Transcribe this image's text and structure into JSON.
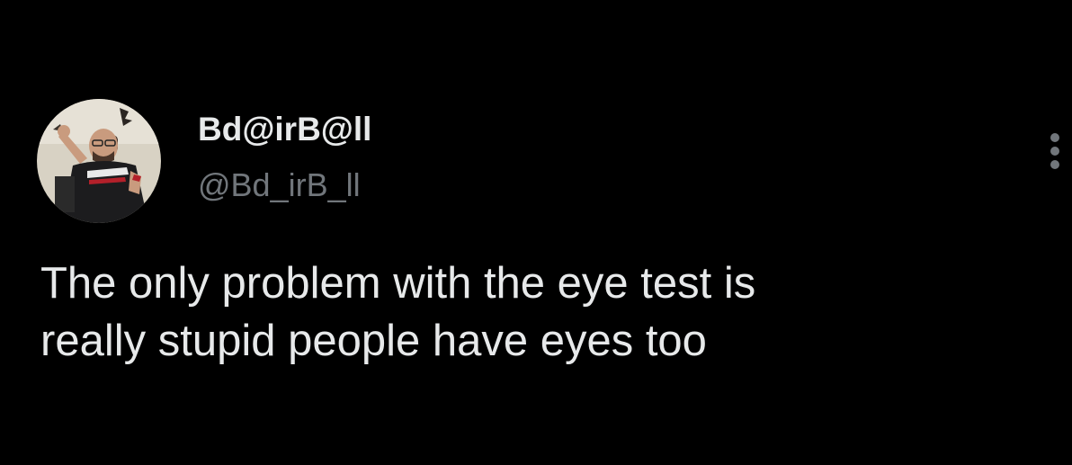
{
  "tweet": {
    "author": {
      "display_name": "Bd@irB@ll",
      "handle": "@Bd_irB_ll",
      "avatar_icon": "user-avatar-photo"
    },
    "menu_icon": "more-vertical-icon",
    "text": "The only problem with the eye test is\nreally stupid people have eyes too"
  },
  "colors": {
    "background": "#000000",
    "primary_text": "#e7e9ea",
    "secondary_text": "#71767b"
  }
}
